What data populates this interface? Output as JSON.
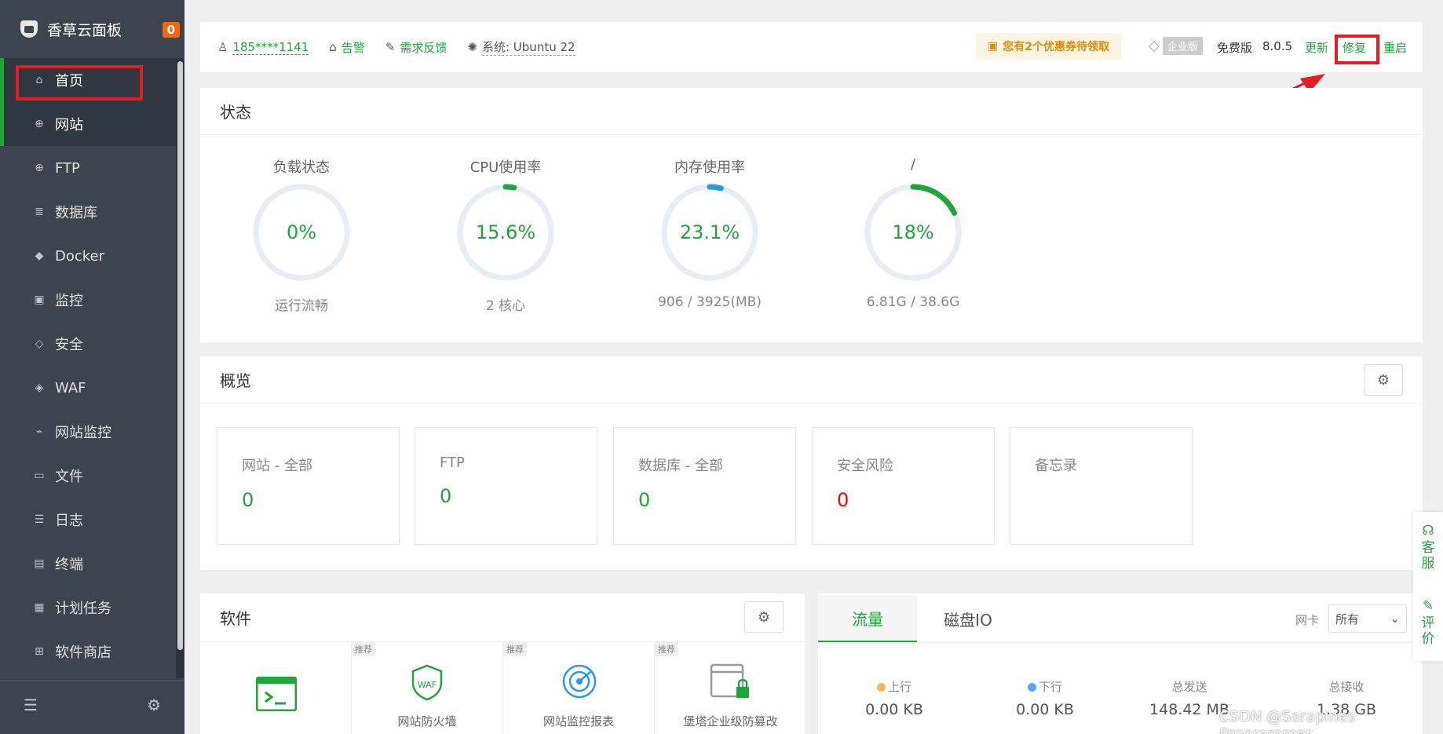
{
  "sidebar": {
    "brand": "香草云面板",
    "badge": "0",
    "items": [
      {
        "label": "首页",
        "icon": "home-icon"
      },
      {
        "label": "网站",
        "icon": "globe-icon"
      },
      {
        "label": "FTP",
        "icon": "ftp-icon"
      },
      {
        "label": "数据库",
        "icon": "database-icon"
      },
      {
        "label": "Docker",
        "icon": "docker-icon"
      },
      {
        "label": "监控",
        "icon": "monitor-icon"
      },
      {
        "label": "安全",
        "icon": "shield-icon"
      },
      {
        "label": "WAF",
        "icon": "waf-shield-icon"
      },
      {
        "label": "网站监控",
        "icon": "chart-icon"
      },
      {
        "label": "文件",
        "icon": "folder-icon"
      },
      {
        "label": "日志",
        "icon": "log-icon"
      },
      {
        "label": "终端",
        "icon": "terminal-icon"
      },
      {
        "label": "计划任务",
        "icon": "calendar-icon"
      },
      {
        "label": "软件商店",
        "icon": "apps-icon"
      }
    ]
  },
  "topbar": {
    "user": "185****1141",
    "alert": "告警",
    "feedback": "需求反馈",
    "system": "系统:  Ubuntu 22",
    "coupon": "您有2个优惠券待领取",
    "enterprise": "企业版",
    "free": "免费版",
    "version": "8.0.5",
    "update": "更新",
    "repair": "修复",
    "restart": "重启"
  },
  "status": {
    "title": "状态",
    "gauges": [
      {
        "title": "负载状态",
        "value": "0%",
        "sub": "运行流畅",
        "percent": 0,
        "color": "#20a53a"
      },
      {
        "title": "CPU使用率",
        "value": "15.6%",
        "sub": "2 核心",
        "percent": 3,
        "color": "#20a53a"
      },
      {
        "title": "内存使用率",
        "value": "23.1%",
        "sub": "906 / 3925(MB)",
        "percent": 4,
        "color": "#2a9bde"
      },
      {
        "title": "/",
        "value": "18%",
        "sub": "6.81G / 38.6G",
        "percent": 18,
        "color": "#20a53a"
      }
    ]
  },
  "overview": {
    "title": "概览",
    "boxes": [
      {
        "label": "网站 - 全部",
        "value": "0"
      },
      {
        "label": "FTP",
        "value": "0"
      },
      {
        "label": "数据库 - 全部",
        "value": "0"
      },
      {
        "label": "安全风险",
        "value": "0"
      },
      {
        "label": "备忘录",
        "value": ""
      }
    ]
  },
  "software": {
    "title": "软件",
    "tag": "推荐",
    "items": [
      {
        "name": "",
        "tag": ""
      },
      {
        "name": "网站防火墙",
        "tag": "推荐"
      },
      {
        "name": "网站监控报表",
        "tag": "推荐"
      },
      {
        "name": "堡塔企业级防篡改",
        "tag": "推荐"
      }
    ]
  },
  "traffic": {
    "tabs": [
      "流量",
      "磁盘IO"
    ],
    "nic_label": "网卡",
    "nic_value": "所有",
    "stats": [
      {
        "label": "上行",
        "value": "0.00 KB"
      },
      {
        "label": "下行",
        "value": "0.00 KB"
      },
      {
        "label": "总发送",
        "value": "148.42 MB"
      },
      {
        "label": "总接收",
        "value": "1.38 GB"
      }
    ]
  },
  "float": {
    "service": "客服",
    "review": "评价"
  },
  "watermark": "CSDN @Sarapines Programmer"
}
